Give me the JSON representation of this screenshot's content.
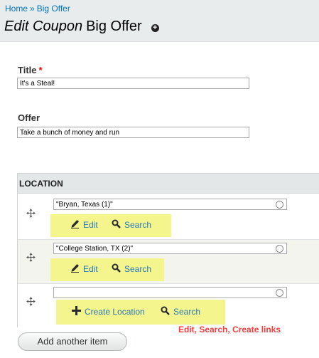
{
  "breadcrumb": {
    "home": "Home",
    "separator": "»",
    "current": "Big Offer"
  },
  "page_title": {
    "prefix": "Edit Coupon",
    "name": "Big Offer",
    "shortcut_icon": "add-shortcut-icon"
  },
  "fields": {
    "title": {
      "label": "Title",
      "required_mark": "*",
      "value": "It's a Steal!"
    },
    "offer": {
      "label": "Offer",
      "value": "Take a bunch of money and run"
    }
  },
  "location": {
    "header": "LOCATION",
    "rows": [
      {
        "value": "\"Bryan, Texas (1)\"",
        "actions": [
          {
            "label": "Edit",
            "icon": "pencil-icon"
          },
          {
            "label": "Search",
            "icon": "magnifier-icon"
          }
        ]
      },
      {
        "value": "\"College Station, TX (2)\"",
        "actions": [
          {
            "label": "Edit",
            "icon": "pencil-icon"
          },
          {
            "label": "Search",
            "icon": "magnifier-icon"
          }
        ]
      },
      {
        "value": "",
        "actions": [
          {
            "label": "Create Location",
            "icon": "plus-icon"
          },
          {
            "label": "Search",
            "icon": "magnifier-icon"
          }
        ]
      }
    ]
  },
  "annotation": "Edit, Search, Create links",
  "add_item_button": "Add another item",
  "colors": {
    "link": "#2a77b8",
    "highlight": "#f5f58e",
    "annotation": "#ff3a3a",
    "header_bg": "#e9ecec"
  }
}
